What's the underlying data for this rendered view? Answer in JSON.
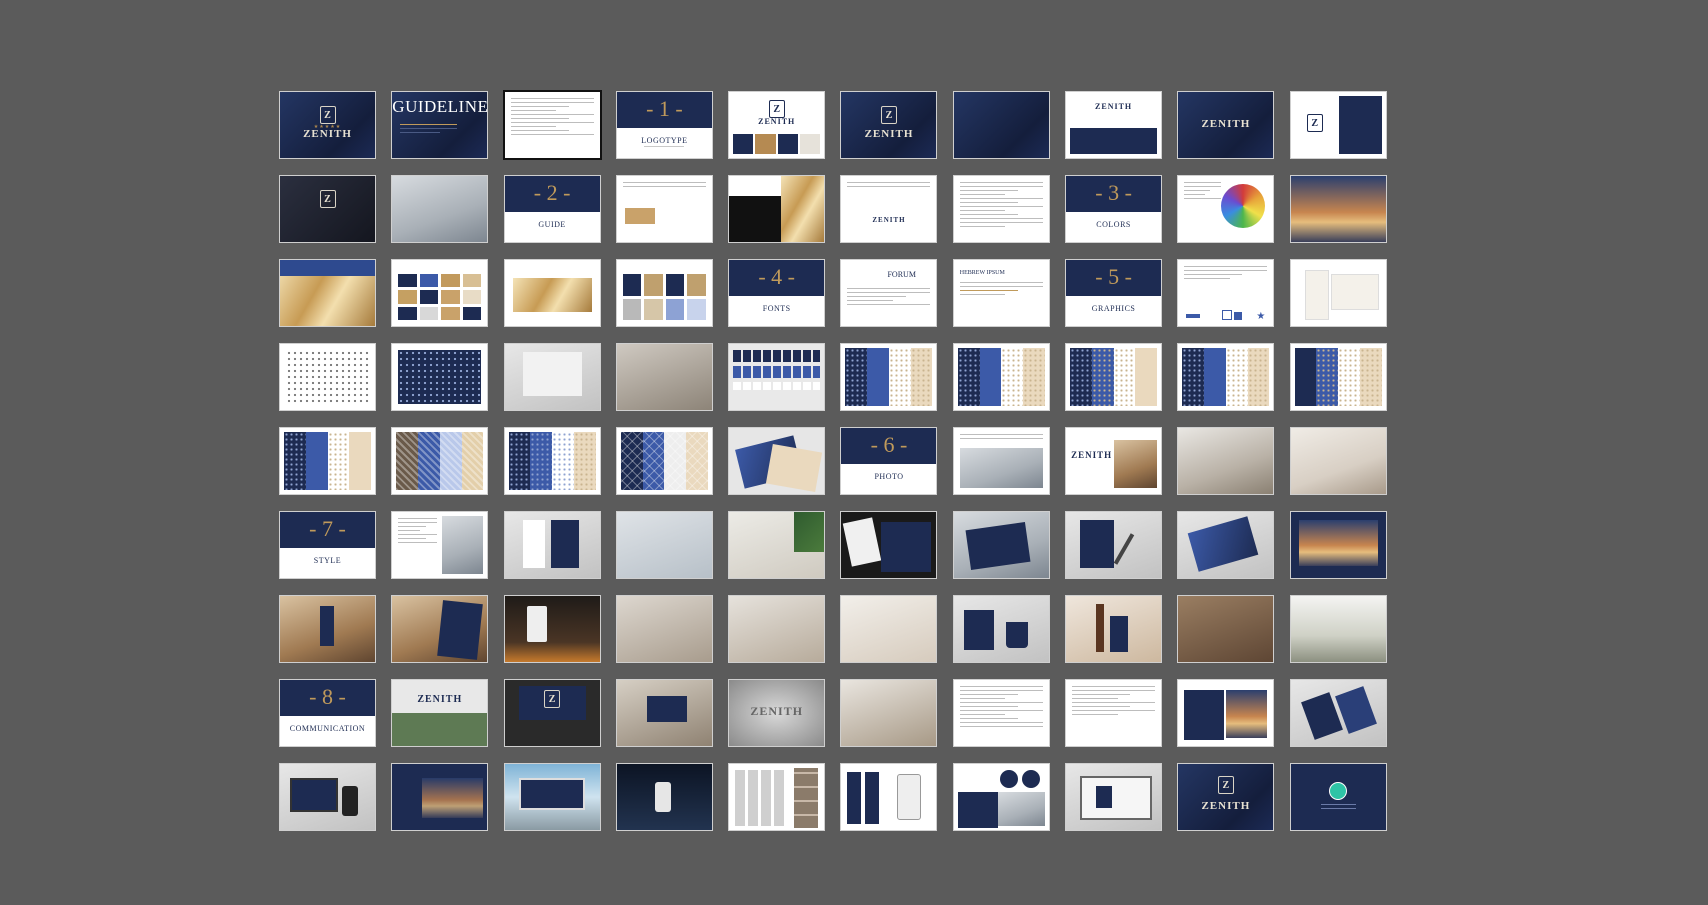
{
  "slides": [
    {
      "variant": "cover-dark"
    },
    {
      "variant": "guideline",
      "title": "GUIDELINE"
    },
    {
      "variant": "toc",
      "selected": true
    },
    {
      "variant": "section",
      "num": "- 1 -",
      "title": "LOGOTYPE"
    },
    {
      "variant": "logo-white",
      "word": "ZENITH"
    },
    {
      "variant": "logo-dark",
      "word": "ZENITH"
    },
    {
      "variant": "navy-plain"
    },
    {
      "variant": "logo-split",
      "word": "ZENITH"
    },
    {
      "variant": "logo-navy",
      "word": "ZENITH"
    },
    {
      "variant": "logo-white-right"
    },
    {
      "variant": "cover-dark-2"
    },
    {
      "variant": "photo-collage"
    },
    {
      "variant": "section",
      "num": "- 2 -",
      "title": "GUIDE"
    },
    {
      "variant": "text-logos"
    },
    {
      "variant": "text-dark-photo"
    },
    {
      "variant": "text-logos-2",
      "word": "ZENITH"
    },
    {
      "variant": "text-doc"
    },
    {
      "variant": "section",
      "num": "- 3 -",
      "title": "COLORS"
    },
    {
      "variant": "color-wheel"
    },
    {
      "variant": "dusk-photo"
    },
    {
      "variant": "gold-photo"
    },
    {
      "variant": "swatch-grid"
    },
    {
      "variant": "gold-band"
    },
    {
      "variant": "swatch-grid-2"
    },
    {
      "variant": "section-navy",
      "num": "- 4 -",
      "title": "FONTS"
    },
    {
      "variant": "fonts-text",
      "title": "FORUM"
    },
    {
      "variant": "fonts-text-2",
      "title": "HEBREW IPSUM"
    },
    {
      "variant": "section",
      "num": "- 5 -",
      "title": "GRAPHICS"
    },
    {
      "variant": "graphics-icons"
    },
    {
      "variant": "card-mock"
    },
    {
      "variant": "icons-white"
    },
    {
      "variant": "icons-navy"
    },
    {
      "variant": "room-pattern"
    },
    {
      "variant": "bedroom-photo"
    },
    {
      "variant": "pattern-squares"
    },
    {
      "variant": "strips-a"
    },
    {
      "variant": "strips-b"
    },
    {
      "variant": "strips-c"
    },
    {
      "variant": "strips-d"
    },
    {
      "variant": "strips-e"
    },
    {
      "variant": "strips-f"
    },
    {
      "variant": "strips-zig"
    },
    {
      "variant": "strips-dots"
    },
    {
      "variant": "strips-diag"
    },
    {
      "variant": "paper-mock"
    },
    {
      "variant": "section-navy",
      "num": "- 6 -",
      "title": "PHOTO"
    },
    {
      "variant": "photo-text"
    },
    {
      "variant": "photo-interior",
      "word": "ZENITH"
    },
    {
      "variant": "photo-bedroom"
    },
    {
      "variant": "photo-people"
    },
    {
      "variant": "section",
      "num": "- 7 -",
      "title": "STYLE"
    },
    {
      "variant": "style-text"
    },
    {
      "variant": "stationery"
    },
    {
      "variant": "paper-leaves"
    },
    {
      "variant": "palm-mock"
    },
    {
      "variant": "card-dark"
    },
    {
      "variant": "folder-mock"
    },
    {
      "variant": "notebook-pen"
    },
    {
      "variant": "folder-blue"
    },
    {
      "variant": "brochure"
    },
    {
      "variant": "door-hanger"
    },
    {
      "variant": "menu-photo"
    },
    {
      "variant": "cup-photo"
    },
    {
      "variant": "bath-photo"
    },
    {
      "variant": "towel-photo"
    },
    {
      "variant": "robe-photo"
    },
    {
      "variant": "bag-mug"
    },
    {
      "variant": "wine-photo"
    },
    {
      "variant": "lobby-photo"
    },
    {
      "variant": "terrace-photo"
    },
    {
      "variant": "section",
      "num": "- 8 -",
      "title": "COMMUNICATION"
    },
    {
      "variant": "sign-board",
      "word": "ZENITH"
    },
    {
      "variant": "sign-dark"
    },
    {
      "variant": "sign-wall"
    },
    {
      "variant": "sign-metal",
      "word": "ZENITH"
    },
    {
      "variant": "lobby-2"
    },
    {
      "variant": "text-doc-2"
    },
    {
      "variant": "text-doc-3"
    },
    {
      "variant": "web-mock"
    },
    {
      "variant": "phones-mock"
    },
    {
      "variant": "devices"
    },
    {
      "variant": "site-dark"
    },
    {
      "variant": "billboard"
    },
    {
      "variant": "phone-hand"
    },
    {
      "variant": "social-grid"
    },
    {
      "variant": "phones-social"
    },
    {
      "variant": "social-circles"
    },
    {
      "variant": "laptop"
    },
    {
      "variant": "end-logo",
      "word": "ZENITH"
    },
    {
      "variant": "contact"
    }
  ]
}
